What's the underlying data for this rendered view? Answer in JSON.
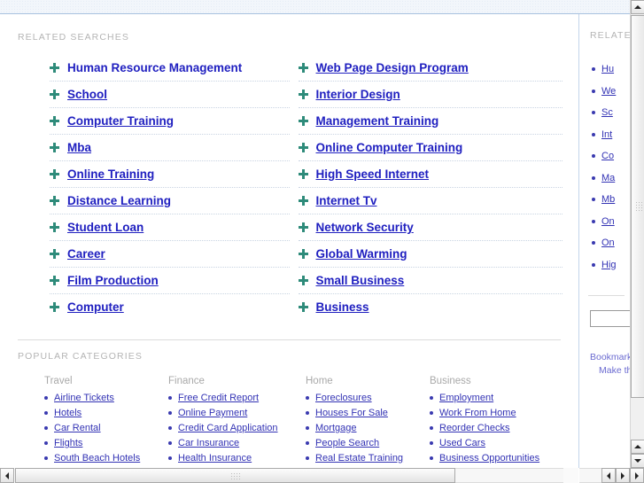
{
  "colors": {
    "link": "#2020c0",
    "label": "#b4b4b4",
    "bullet": "#2e8b7a",
    "header_band": "#f2f6fb",
    "header_border": "#a8c2e0",
    "small_link": "#3232b4"
  },
  "main": {
    "related_searches_label": "RELATED SEARCHES",
    "related_searches": {
      "left_column": [
        "Human Resource Management",
        "School",
        "Computer Training",
        "Mba",
        "Online Training",
        "Distance Learning",
        "Student Loan",
        "Career",
        "Film Production",
        "Computer"
      ],
      "right_column": [
        "Web Page Design Program",
        "Interior Design",
        "Management Training",
        "Online Computer Training",
        "High Speed Internet",
        "Internet Tv",
        "Network Security",
        "Global Warming",
        "Small Business",
        "Business"
      ]
    },
    "popular_categories_label": "POPULAR CATEGORIES",
    "popular_categories": [
      {
        "heading": "Travel",
        "items": [
          "Airline Tickets",
          "Hotels",
          "Car Rental",
          "Flights",
          "South Beach Hotels"
        ]
      },
      {
        "heading": "Finance",
        "items": [
          "Free Credit Report",
          "Online Payment",
          "Credit Card Application",
          "Car Insurance",
          "Health Insurance"
        ]
      },
      {
        "heading": "Home",
        "items": [
          "Foreclosures",
          "Houses For Sale",
          "Mortgage",
          "People Search",
          "Real Estate Training"
        ]
      },
      {
        "heading": "Business",
        "items": [
          "Employment",
          "Work From Home",
          "Reorder Checks",
          "Used Cars",
          "Business Opportunities"
        ]
      }
    ]
  },
  "side_panel": {
    "related_label": "RELATED",
    "items": [
      "Hu",
      "We",
      "Sc",
      "Int",
      "Co",
      "Ma",
      "Mb",
      "On",
      "On",
      "Hig"
    ],
    "search_value": "",
    "bookmark_label": "Bookmark",
    "make_home_label": "Make this"
  }
}
